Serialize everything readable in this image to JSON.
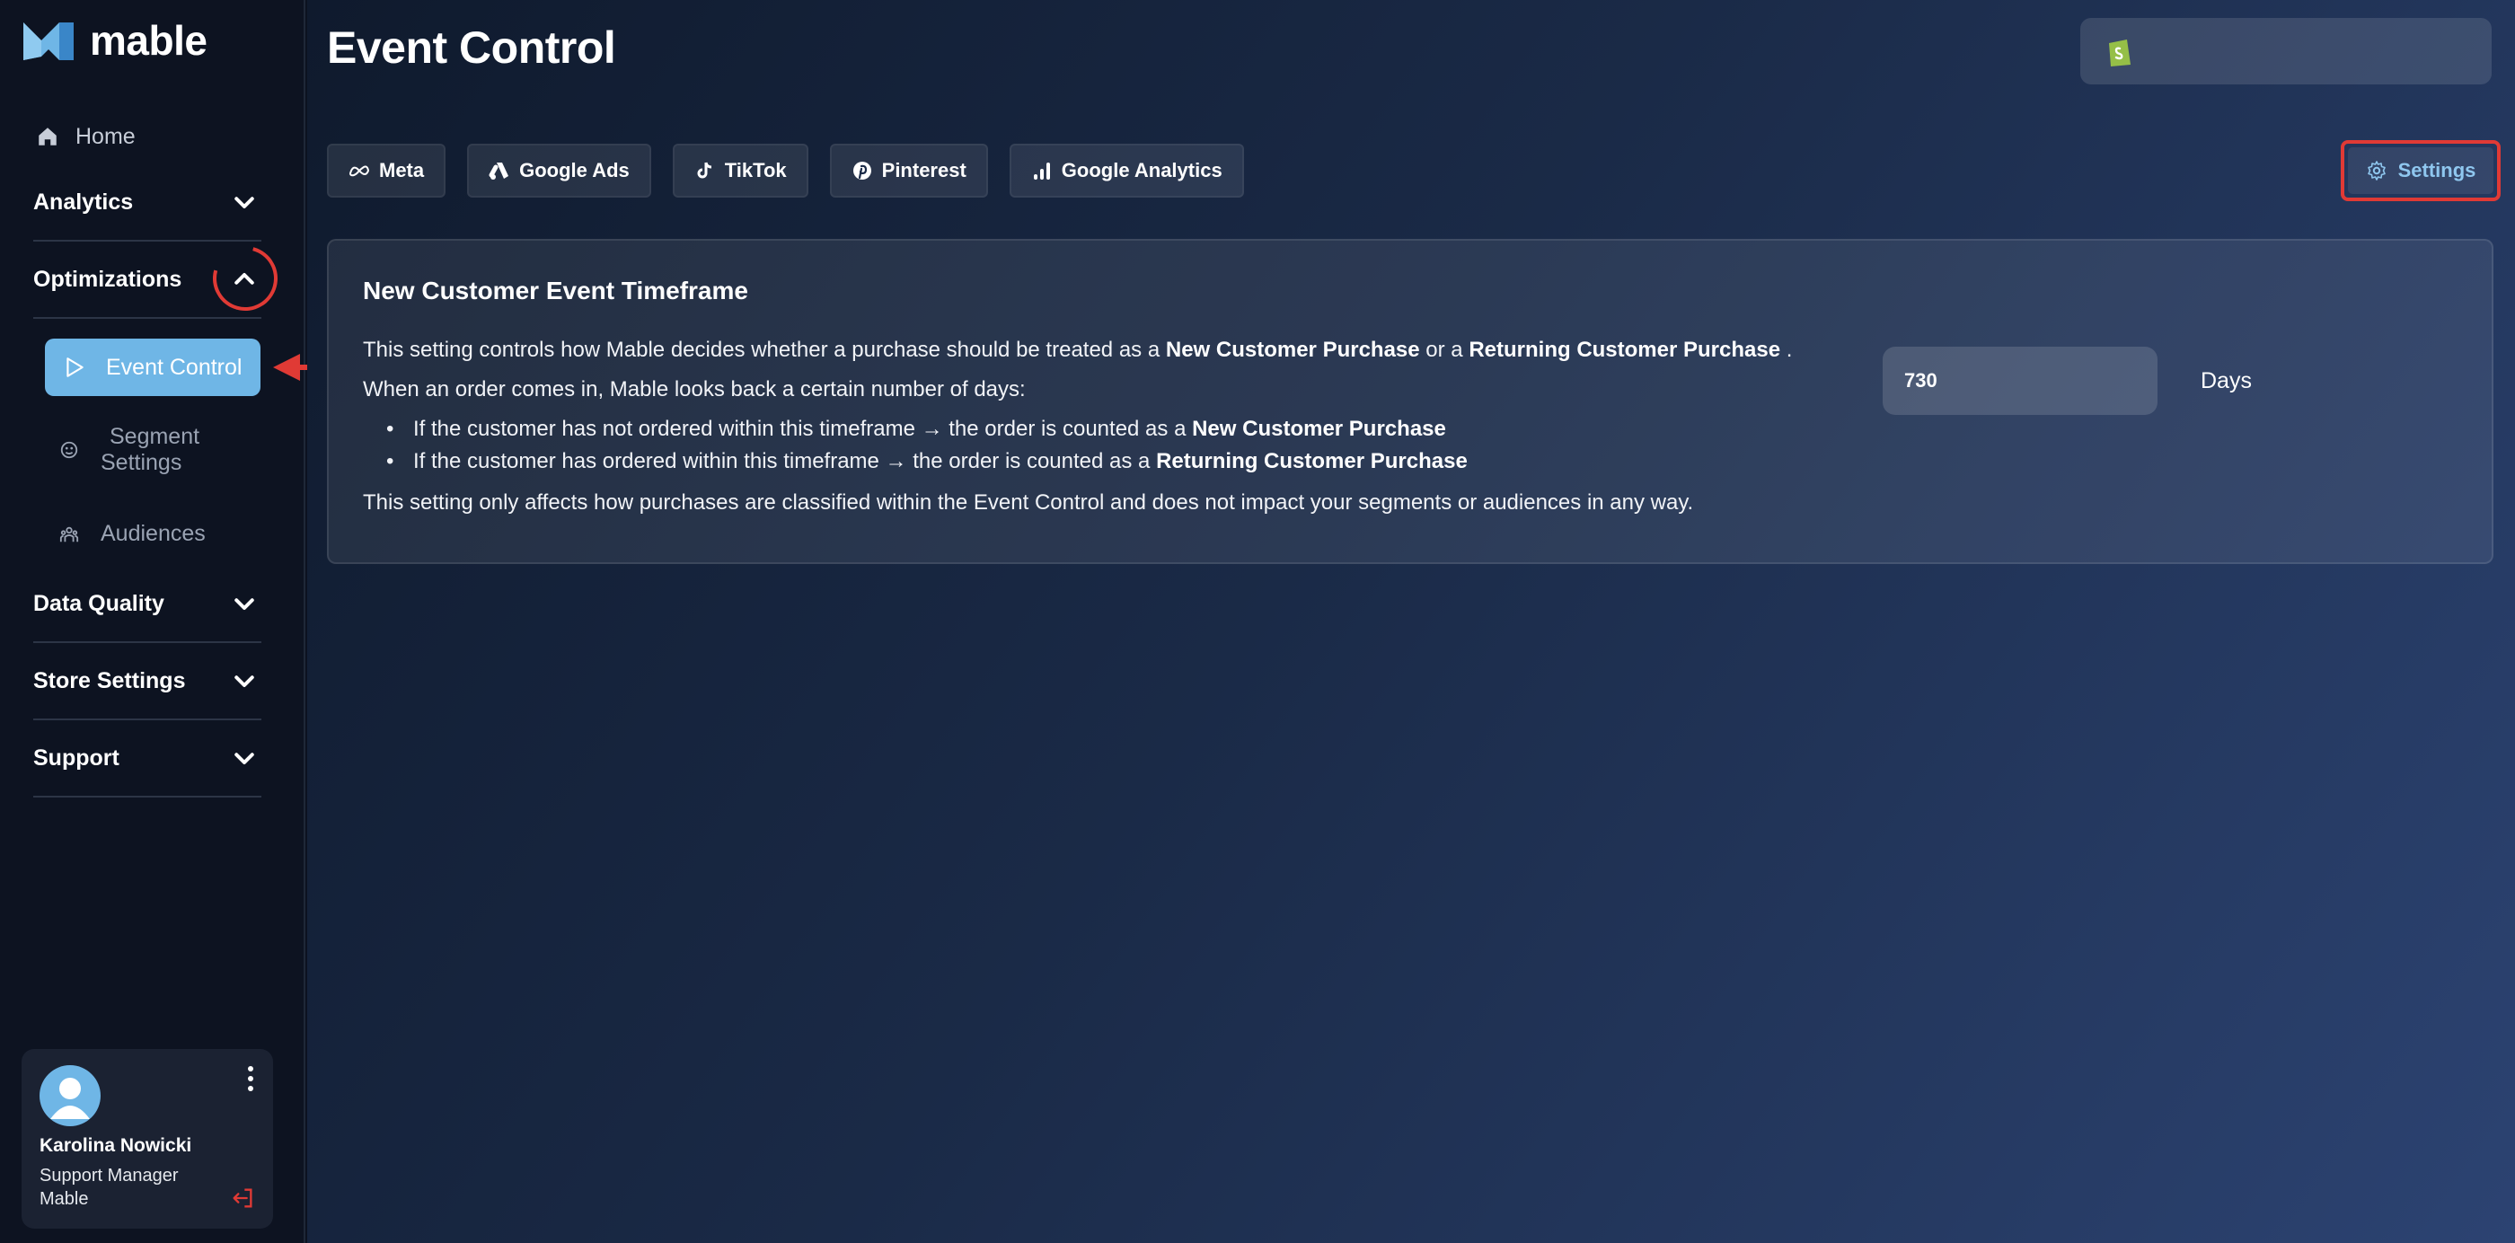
{
  "app": {
    "name": "mable"
  },
  "sidebar": {
    "home": "Home",
    "groups": {
      "analytics": "Analytics",
      "optimizations": "Optimizations",
      "data_quality": "Data Quality",
      "store_settings": "Store Settings",
      "support": "Support"
    },
    "optimizations_items": {
      "event_control": "Event Control",
      "segment_settings_line1": "Segment",
      "segment_settings_line2": "Settings",
      "audiences": "Audiences"
    }
  },
  "user": {
    "name": "Karolina Nowicki",
    "role": "Support Manager",
    "company": "Mable"
  },
  "main": {
    "title": "Event Control",
    "tabs": {
      "meta": "Meta",
      "google_ads": "Google Ads",
      "tiktok": "TikTok",
      "pinterest": "Pinterest",
      "google_analytics": "Google Analytics"
    },
    "settings_label": "Settings"
  },
  "card": {
    "title": "New Customer Event Timeframe",
    "line1": {
      "a": "This setting controls how Mable decides whether a purchase should be treated as a ",
      "b": "New Customer Purchase",
      "c": " or a ",
      "d": "Returning Customer Purchase",
      "e": " ."
    },
    "line2": "When an order comes in, Mable looks back a certain number of days:",
    "bullet1": {
      "a": "If the customer has not ordered within this timeframe → the order is counted as a ",
      "b": "New Customer Purchase"
    },
    "bullet2": {
      "a": "If the customer has ordered within this timeframe → the order is counted as a ",
      "b": "Returning Customer Purchase"
    },
    "footer": "This setting only affects how purchases are classified within the Event Control and does not impact your segments or audiences in any way.",
    "days_value": "730",
    "days_label": "Days"
  },
  "colors": {
    "accent": "#6fb6e6",
    "annotation": "#e03a35",
    "sidebar_bg": "#0d1321",
    "shopify_green": "#95bf47"
  },
  "icons": {
    "logo": "mable-logo-icon",
    "home": "home-icon",
    "event_control": "play-outline-icon",
    "segment_settings": "segment-icon",
    "audiences": "audiences-icon",
    "meta": "meta-icon",
    "google_ads": "google-ads-icon",
    "tiktok": "tiktok-icon",
    "pinterest": "pinterest-icon",
    "google_analytics": "google-analytics-icon",
    "settings": "gear-icon",
    "store": "shopify-icon",
    "kebab": "kebab-menu-icon",
    "logout": "logout-icon",
    "avatar": "user-avatar-icon"
  }
}
